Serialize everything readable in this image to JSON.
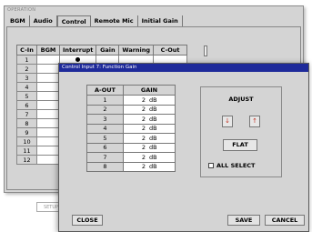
{
  "back_window": {
    "title": "OPERATION",
    "tabs": [
      "BGM",
      "Audio",
      "Control",
      "Remote Mic",
      "Initial Gain"
    ],
    "active_tab": "Control",
    "grid_headers": [
      "C-In",
      "BGM",
      "Interrupt",
      "Gain",
      "Warning",
      "C-Out"
    ],
    "rows": [
      "1",
      "2",
      "3",
      "4",
      "5",
      "6",
      "7",
      "8",
      "9",
      "10",
      "11",
      "12"
    ],
    "interrupt_marks": [
      true,
      true,
      false,
      false,
      false,
      false,
      false,
      false,
      false,
      false,
      false,
      false
    ],
    "setup_label": "SETUP"
  },
  "dialog": {
    "title": "Control Input 7: Function Gain",
    "table_headers": [
      "A-OUT",
      "GAIN"
    ],
    "rows": [
      {
        "out": "1",
        "gain": "2",
        "unit": "dB"
      },
      {
        "out": "2",
        "gain": "2",
        "unit": "dB"
      },
      {
        "out": "3",
        "gain": "2",
        "unit": "dB"
      },
      {
        "out": "4",
        "gain": "2",
        "unit": "dB"
      },
      {
        "out": "5",
        "gain": "2",
        "unit": "dB"
      },
      {
        "out": "6",
        "gain": "2",
        "unit": "dB"
      },
      {
        "out": "7",
        "gain": "2",
        "unit": "dB"
      },
      {
        "out": "8",
        "gain": "2",
        "unit": "dB"
      }
    ],
    "adjust_label": "ADJUST",
    "down_icon": "arrow-down-icon",
    "up_icon": "arrow-up-icon",
    "flat_label": "FLAT",
    "all_select_label": "ALL SELECT",
    "close_label": "CLOSE",
    "save_label": "SAVE",
    "cancel_label": "CANCEL"
  }
}
